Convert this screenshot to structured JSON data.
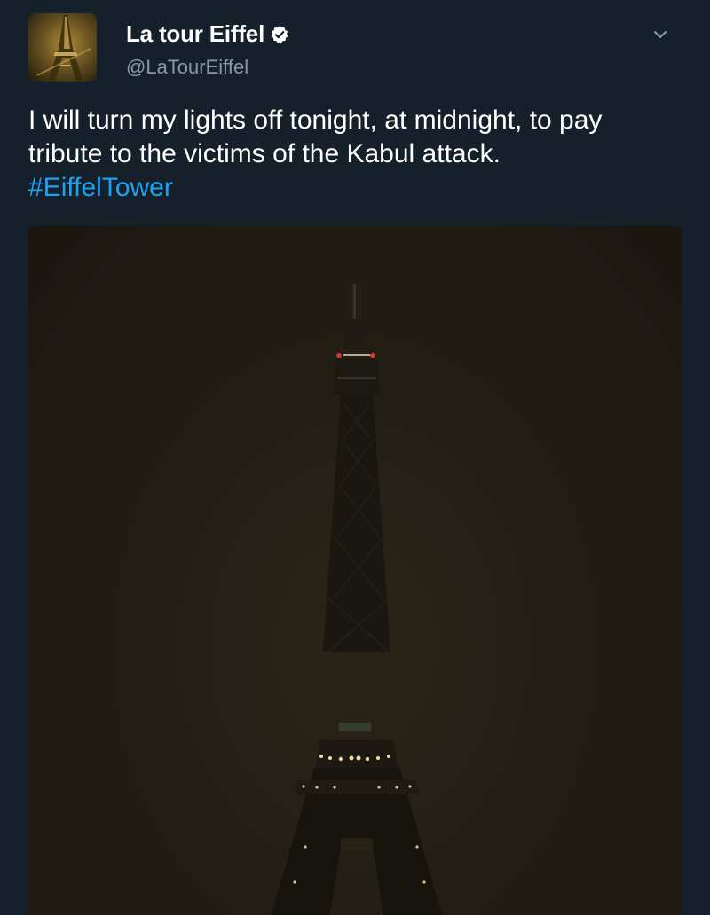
{
  "tweet": {
    "author": {
      "display_name": "La tour Eiffel",
      "handle": "@LaTourEiffel",
      "verified": true,
      "avatar_icon": "eiffel-tower-avatar-icon"
    },
    "menu_icon": "chevron-down-icon",
    "text_lines": [
      "I will turn my lights off tonight, at midnight, to pay",
      "tribute to the victims of the Kabul attack."
    ],
    "hashtag": "#EiffelTower",
    "media": {
      "image_icon": "eiffel-tower-night-photo"
    }
  },
  "colors": {
    "background": "#15202b",
    "text": "#ffffff",
    "secondary_text": "#8899a6",
    "link": "#1da1f2"
  }
}
